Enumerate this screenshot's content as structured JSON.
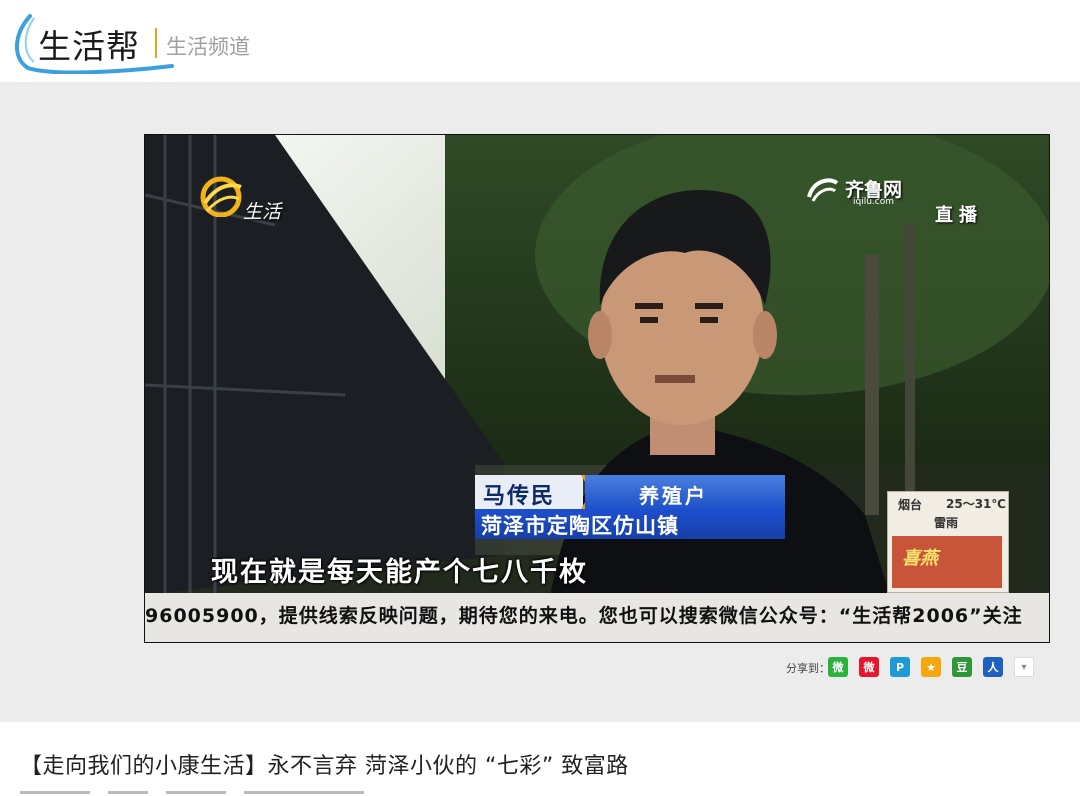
{
  "header": {
    "logo_text": "生活帮",
    "channel_text": "生活频道"
  },
  "video": {
    "channel_logo_text": "生活",
    "site_logo_name": "齐鲁网",
    "site_logo_url": "iqilu.com",
    "live_label": "直播",
    "lower_third": {
      "name": "马传民",
      "role": "养殖户",
      "place": "菏泽市定陶区仿山镇"
    },
    "subtitle": "现在就是每天能产个七八千枚",
    "weather": {
      "city": "烟台",
      "temp": "25～31℃",
      "condition": "雷雨",
      "ad_text": "喜燕"
    },
    "ticker": "96005900，提供线索反映问题，期待您的来电。您也可以搜索微信公众号：“生活帮2006”关注"
  },
  "share": {
    "label": "分享到：",
    "icons": [
      {
        "name": "wechat-icon",
        "glyph": "微",
        "color": "#2bb13c"
      },
      {
        "name": "weibo-icon",
        "glyph": "微",
        "color": "#e6162d"
      },
      {
        "name": "tencent-weibo-icon",
        "glyph": "P",
        "color": "#1e9bd7"
      },
      {
        "name": "qzone-icon",
        "glyph": "★",
        "color": "#f5a70e"
      },
      {
        "name": "douban-icon",
        "glyph": "豆",
        "color": "#2f963a"
      },
      {
        "name": "renren-icon",
        "glyph": "人",
        "color": "#1f5fbf"
      }
    ]
  },
  "article": {
    "title": "【走向我们的小康生活】永不言弃 菏泽小伙的 “七彩” 致富路"
  }
}
